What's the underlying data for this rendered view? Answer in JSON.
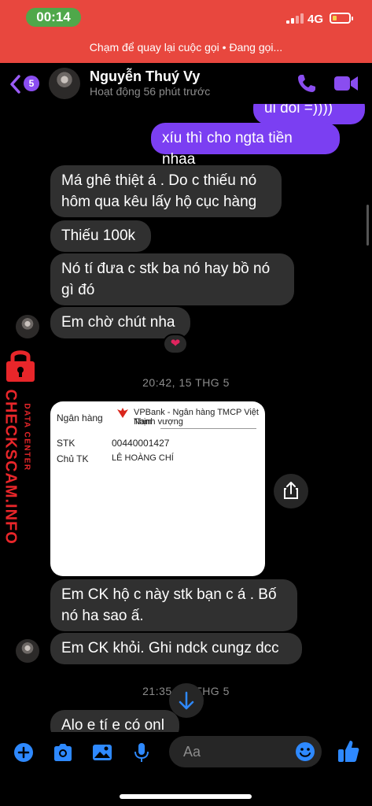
{
  "status_bar": {
    "time": "00:14",
    "network": "4G"
  },
  "call_banner": {
    "text": "Chạm để quay lại cuộc gọi • Đang gọi..."
  },
  "header": {
    "back_badge": "5",
    "contact_name": "Nguyễn Thuý Vy",
    "contact_status": "Hoạt động 56 phút trước"
  },
  "messages": {
    "out_partial": "ui dồi =))))",
    "out_1": "xíu thì cho ngta tiền nhaa",
    "in_1_line1": "Má ghê thiệt á . Do c thiếu nó",
    "in_1_line2": "hôm qua kêu lấy hộ cục hàng",
    "in_2": "Thiếu 100k",
    "in_3_line1": "Nó tí đưa c stk ba nó hay bồ nó",
    "in_3_line2": "gì đó",
    "in_4": "Em chờ chút nha",
    "reaction": "❤",
    "timestamp_1": "20:42, 15 THG 5",
    "in_5_line1": "Em CK hộ c này stk bạn c á . Bố",
    "in_5_line2": "nó ha sao ấ.",
    "in_6": "Em CK khỏi. Ghi ndck cungz dcc",
    "timestamp_2": "21:35, 15 THG 5",
    "in_7_partial": "Alo e tí e có onl"
  },
  "bank_card": {
    "bank_label": "Ngân hàng",
    "bank_name_line1": "VPBank - Ngân hàng TMCP Việt Nam",
    "bank_name_line2": "Thịnh vượng",
    "account_label": "STK",
    "account_number": "00440001427",
    "holder_label": "Chủ TK",
    "holder_name": "LÊ HOÀNG CHÍ"
  },
  "watermark": {
    "brand": "CHECKSCAM.INFO",
    "sub": "DATA CENTER"
  },
  "composer": {
    "placeholder": "Aa"
  },
  "colors": {
    "accent": "#7b3ff2",
    "incoming": "#303030",
    "banner": "#e8473e",
    "icon_blue": "#2e89ff",
    "watermark": "#e8262a"
  },
  "icons": [
    "back-chevron-icon",
    "phone-icon",
    "video-camera-icon",
    "share-icon",
    "arrow-down-icon",
    "plus-icon",
    "camera-icon",
    "image-icon",
    "microphone-icon",
    "emoji-icon",
    "thumbs-up-icon",
    "lock-icon"
  ]
}
